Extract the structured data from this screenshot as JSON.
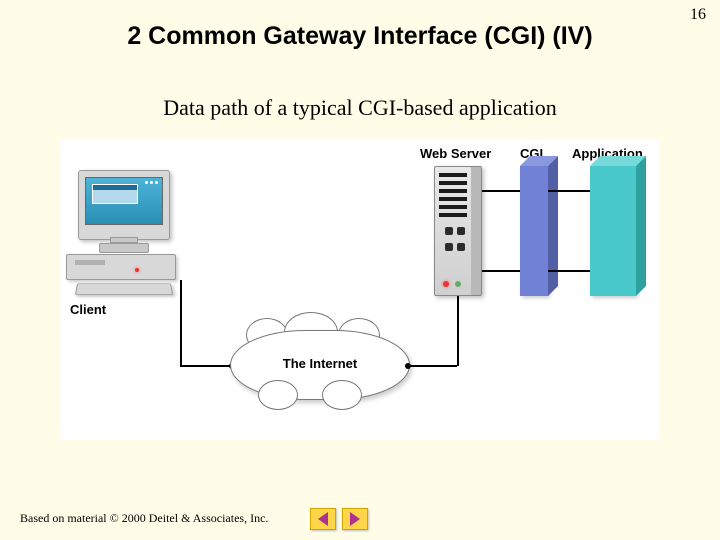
{
  "page_number": "16",
  "title": "2 Common Gateway Interface (CGI) (IV)",
  "subtitle": "Data path of a typical CGI-based application",
  "diagram": {
    "labels": {
      "client": "Client",
      "internet": "The Internet",
      "webserver": "Web Server",
      "cgi": "CGI",
      "application": "Application"
    }
  },
  "footer": "Based on material © 2000 Deitel & Associates, Inc."
}
